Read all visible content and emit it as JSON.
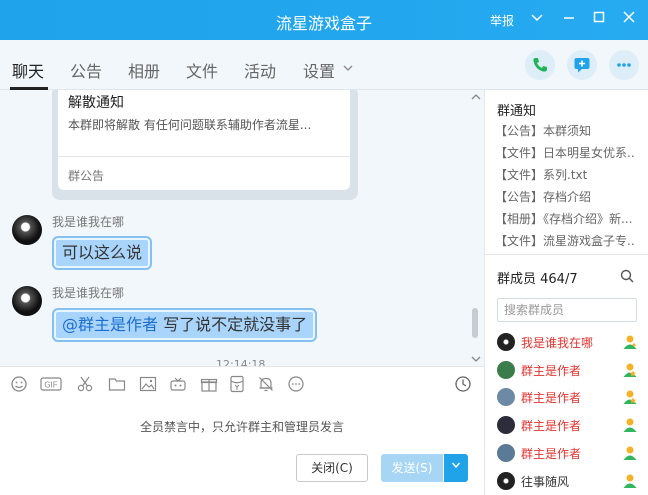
{
  "window": {
    "title": "流星游戏盒子",
    "report_label": "举报",
    "controls": [
      "chevron-down-icon",
      "minimize-icon",
      "maximize-icon",
      "close-icon"
    ]
  },
  "tabs": [
    {
      "label": "聊天",
      "active": true
    },
    {
      "label": "公告",
      "active": false
    },
    {
      "label": "相册",
      "active": false
    },
    {
      "label": "文件",
      "active": false
    },
    {
      "label": "活动",
      "active": false
    },
    {
      "label": "设置",
      "active": false
    }
  ],
  "header_actions": [
    "phone-icon",
    "add-message-icon",
    "more-icon"
  ],
  "chat": {
    "notice_card": {
      "title": "解散通知",
      "body": "本群即将解散 有任何问题联系辅助作者流星...",
      "footer": "群公告"
    },
    "messages": [
      {
        "sender": "我是谁我在哪",
        "text": "可以这么说"
      },
      {
        "sender": "我是谁我在哪",
        "mention": "@群主是作者",
        "text": "写了说不定就没事了"
      }
    ],
    "timestamp": "12:14:18"
  },
  "toolbar": {
    "icons": [
      "emoji-icon",
      "gif-icon",
      "scissors-icon",
      "folder-icon",
      "image-icon",
      "game-icon",
      "gift-icon",
      "red-packet-icon",
      "bell-off-icon",
      "more-circle-icon",
      "history-clock-icon"
    ],
    "gif_label": "GIF"
  },
  "input": {
    "mute_notice": "全员禁言中，只允许群主和管理员发言",
    "close_label": "关闭(C)",
    "send_label": "发送(S)"
  },
  "side": {
    "notice_header": "群通知",
    "notices": [
      "【公告】本群须知",
      "【文件】日本明星女优系...",
      "【文件】系列.txt",
      "【公告】存档介绍",
      "【相册】《存档介绍》新...",
      "【文件】流星游戏盒子专..."
    ],
    "members_header": "群成员 464/7",
    "member_search_placeholder": "搜索群成员",
    "members": [
      {
        "name": "我是谁我在哪",
        "role": "admin"
      },
      {
        "name": "群主是作者",
        "role": "owner"
      },
      {
        "name": "群主是作者",
        "role": "owner"
      },
      {
        "name": "群主是作者",
        "role": "member"
      },
      {
        "name": "群主是作者",
        "role": "member"
      },
      {
        "name": "往事随风",
        "role": "member"
      }
    ],
    "colors": {
      "member_name": "#e0342f",
      "accent": "#21a3ea"
    }
  }
}
